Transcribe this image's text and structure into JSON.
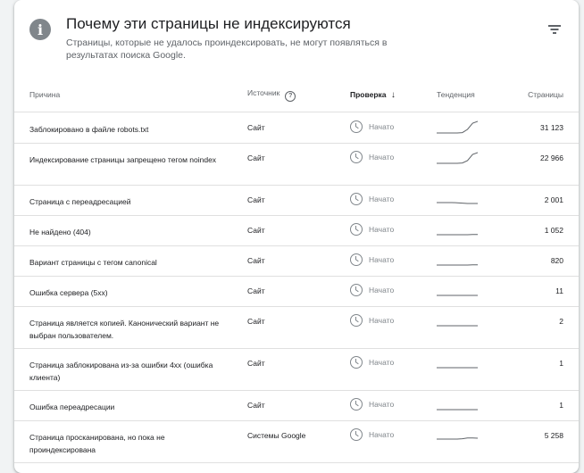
{
  "header": {
    "title": "Почему эти страницы не индексируются",
    "subtitle": "Страницы, которые не удалось проиндексировать, не могут появляться в результатах поиска Google.",
    "info_icon": "info-icon",
    "filter_icon": "filter-icon"
  },
  "columns": {
    "reason": "Причина",
    "source": "Источник",
    "status": "Проверка",
    "trend": "Тенденция",
    "pages": "Страницы"
  },
  "rows": [
    {
      "reason": "Заблокировано в файле robots.txt",
      "source": "Сайт",
      "status": "Начато",
      "pages": "31 123",
      "trend": [
        0.2,
        0.2,
        0.2,
        0.2,
        0.2,
        0.22,
        0.4,
        0.75,
        0.85
      ]
    },
    {
      "reason": "Индексирование страницы запрещено тегом noindex",
      "source": "Сайт",
      "status": "Начато",
      "pages": "22 966",
      "trend": [
        0.2,
        0.2,
        0.2,
        0.2,
        0.2,
        0.22,
        0.35,
        0.7,
        0.8
      ]
    },
    {
      "reason": "Страница с переадресацией",
      "source": "Сайт",
      "status": "Начато",
      "pages": "2 001",
      "trend": [
        0.35,
        0.35,
        0.35,
        0.35,
        0.34,
        0.32,
        0.3,
        0.3,
        0.3
      ]
    },
    {
      "reason": "Не найдено (404)",
      "source": "Сайт",
      "status": "Начато",
      "pages": "1 052",
      "trend": [
        0.25,
        0.25,
        0.25,
        0.25,
        0.25,
        0.25,
        0.25,
        0.26,
        0.26
      ]
    },
    {
      "reason": "Вариант страницы с тегом canonical",
      "source": "Сайт",
      "status": "Начато",
      "pages": "820",
      "trend": [
        0.25,
        0.25,
        0.25,
        0.25,
        0.25,
        0.25,
        0.25,
        0.26,
        0.26
      ]
    },
    {
      "reason": "Ошибка сервера (5xx)",
      "source": "Сайт",
      "status": "Начато",
      "pages": "11",
      "trend": [
        0.25,
        0.25,
        0.25,
        0.25,
        0.25,
        0.25,
        0.25,
        0.25,
        0.25
      ]
    },
    {
      "reason": "Страница является копией. Канонический вариант не выбран пользователем.",
      "source": "Сайт",
      "status": "Начато",
      "pages": "2",
      "trend": [
        0.25,
        0.25,
        0.25,
        0.25,
        0.25,
        0.25,
        0.25,
        0.25,
        0.25
      ]
    },
    {
      "reason": "Страница заблокирована из-за ошибки 4xx (ошибка клиента)",
      "source": "Сайт",
      "status": "Начато",
      "pages": "1",
      "trend": [
        0.25,
        0.25,
        0.25,
        0.25,
        0.25,
        0.25,
        0.25,
        0.25,
        0.25
      ]
    },
    {
      "reason": "Ошибка переадресации",
      "source": "Сайт",
      "status": "Начато",
      "pages": "1",
      "trend": [
        0.25,
        0.25,
        0.25,
        0.25,
        0.25,
        0.25,
        0.25,
        0.25,
        0.25
      ]
    },
    {
      "reason": "Страница просканирована, но пока не проиндексирована",
      "source": "Системы Google",
      "status": "Начато",
      "pages": "5 258",
      "trend": [
        0.3,
        0.3,
        0.3,
        0.3,
        0.3,
        0.32,
        0.36,
        0.36,
        0.35
      ]
    }
  ],
  "colors": {
    "trend_line": "#5f6368",
    "text_primary": "#202124",
    "text_secondary": "#5f6368",
    "divider": "#e0e0e0"
  }
}
